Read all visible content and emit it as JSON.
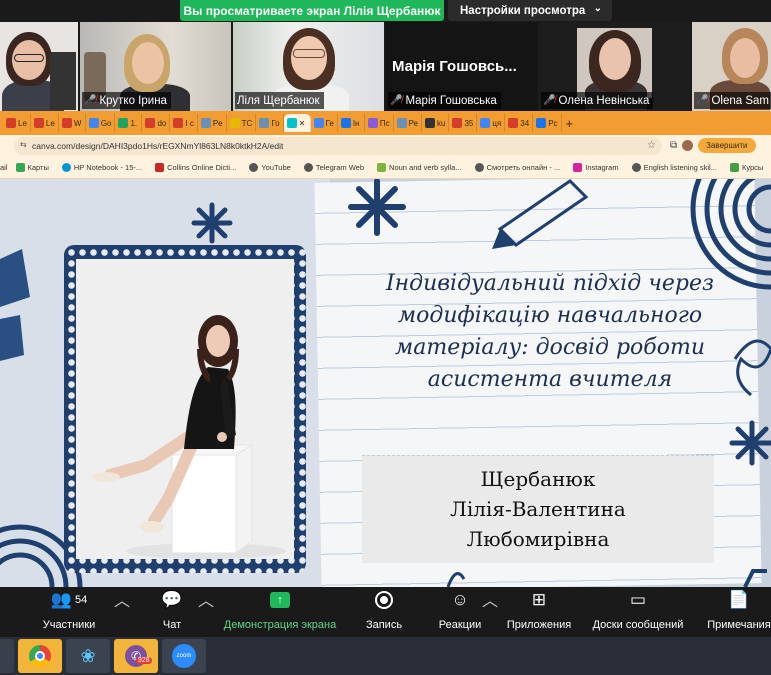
{
  "zoom": {
    "share_banner": "Вы просматриваете экран Лілія Щербанюк",
    "view_options": "Настройки просмотра",
    "participants": [
      {
        "name": ""
      },
      {
        "name": "Крутко Ірина",
        "muted": true
      },
      {
        "name": "Ліля Щербанюк",
        "muted": false,
        "active": true
      },
      {
        "name": "Марія Гошовська",
        "muted": true,
        "display_text": "Марія Гошовсь..."
      },
      {
        "name": "Олена Невінська",
        "muted": true
      },
      {
        "name": "Olena Sam",
        "muted": true
      }
    ],
    "toolbar": {
      "participants_label": "Участники",
      "participants_count": "54",
      "chat_label": "Чат",
      "share_label": "Демонстрация экрана",
      "record_label": "Запись",
      "reactions_label": "Реакции",
      "apps_label": "Приложения",
      "whiteboard_label": "Доски сообщений",
      "notes_label": "Примечания"
    }
  },
  "browser": {
    "tabs": [
      "Le",
      "Le",
      "W",
      "Go",
      "1.",
      "do",
      "I c",
      "Pe",
      "TC",
      "Го",
      "",
      "Ге",
      "Ін",
      "Пс",
      "Ре",
      "ku",
      "35",
      "ця",
      "34",
      "Pc"
    ],
    "url": "canva.com/design/DAHI3pdo1Hs/rEGXNmYl863LN8k0ktkH2A/edit",
    "share_button": "Завершити",
    "bookmarks": [
      "ail",
      "Карты",
      "HP Notebook - 15-...",
      "Collins Online Dicti...",
      "YouTube",
      "Telegram Web",
      "Noun and verb sylla...",
      "Смотреть онлайн - ...",
      "Instagram",
      "English listening skil...",
      "Курсы"
    ]
  },
  "slide": {
    "title_lines": [
      "Індивідуальний підхід через",
      "модифікацію навчального",
      "матеріалу: досвід роботи",
      "асистента вчителя"
    ],
    "author_lines": [
      "Щербанюк",
      "Лілія-Валентина",
      "Любомирівна"
    ]
  },
  "taskbar": {
    "viber_badge": "928",
    "zoom_label": "zoom"
  }
}
